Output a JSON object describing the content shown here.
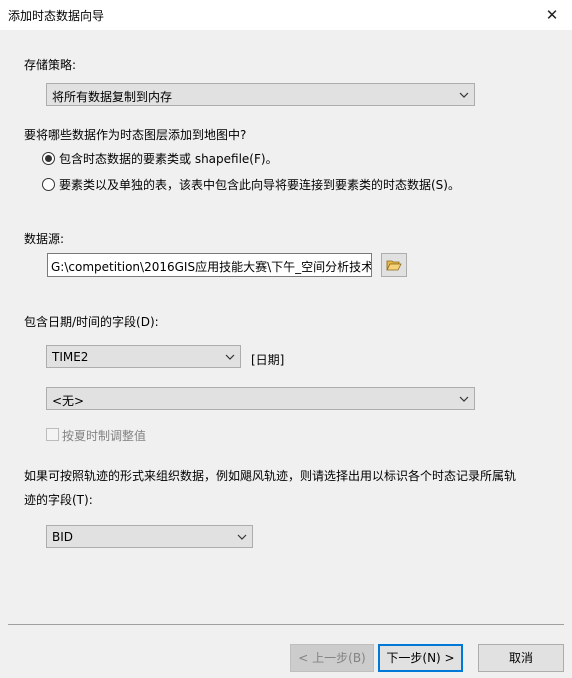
{
  "window": {
    "title": "添加时态数据向导",
    "close_glyph": "✕"
  },
  "storage": {
    "label": "存储策略:",
    "selected": "将所有数据复制到内存"
  },
  "layer_question": {
    "label": "要将哪些数据作为时态图层添加到地图中?",
    "options": [
      {
        "label": "包含时态数据的要素类或 shapefile(F)。",
        "checked": true
      },
      {
        "label": "要素类以及单独的表，该表中包含此向导将要连接到要素类的时态数据(S)。",
        "checked": false
      }
    ]
  },
  "data_source": {
    "label": "数据源:",
    "value": "G:\\competition\\2016GIS应用技能大赛\\下午_空间分析技术",
    "browse_icon": "folder-open-icon"
  },
  "datetime_field": {
    "label": "包含日期/时间的字段(D):",
    "selected": "TIME2",
    "type_label": "[日期]",
    "second_selected": "<无>",
    "dst_label": "按夏时制调整值",
    "dst_checked": false
  },
  "track_field": {
    "label_line1": "如果可按照轨迹的形式来组织数据，例如飓风轨迹，则请选择出用以标识各个时态记录所属轨",
    "label_line2": "迹的字段(T):",
    "selected": "BID"
  },
  "footer": {
    "back_label": "< 上一步(B)",
    "next_label": "下一步(N) >",
    "cancel_label": "取消"
  },
  "colors": {
    "dialog_bg": "#f0f0f0",
    "accent": "#0078d7",
    "disabled_text": "#838383"
  }
}
